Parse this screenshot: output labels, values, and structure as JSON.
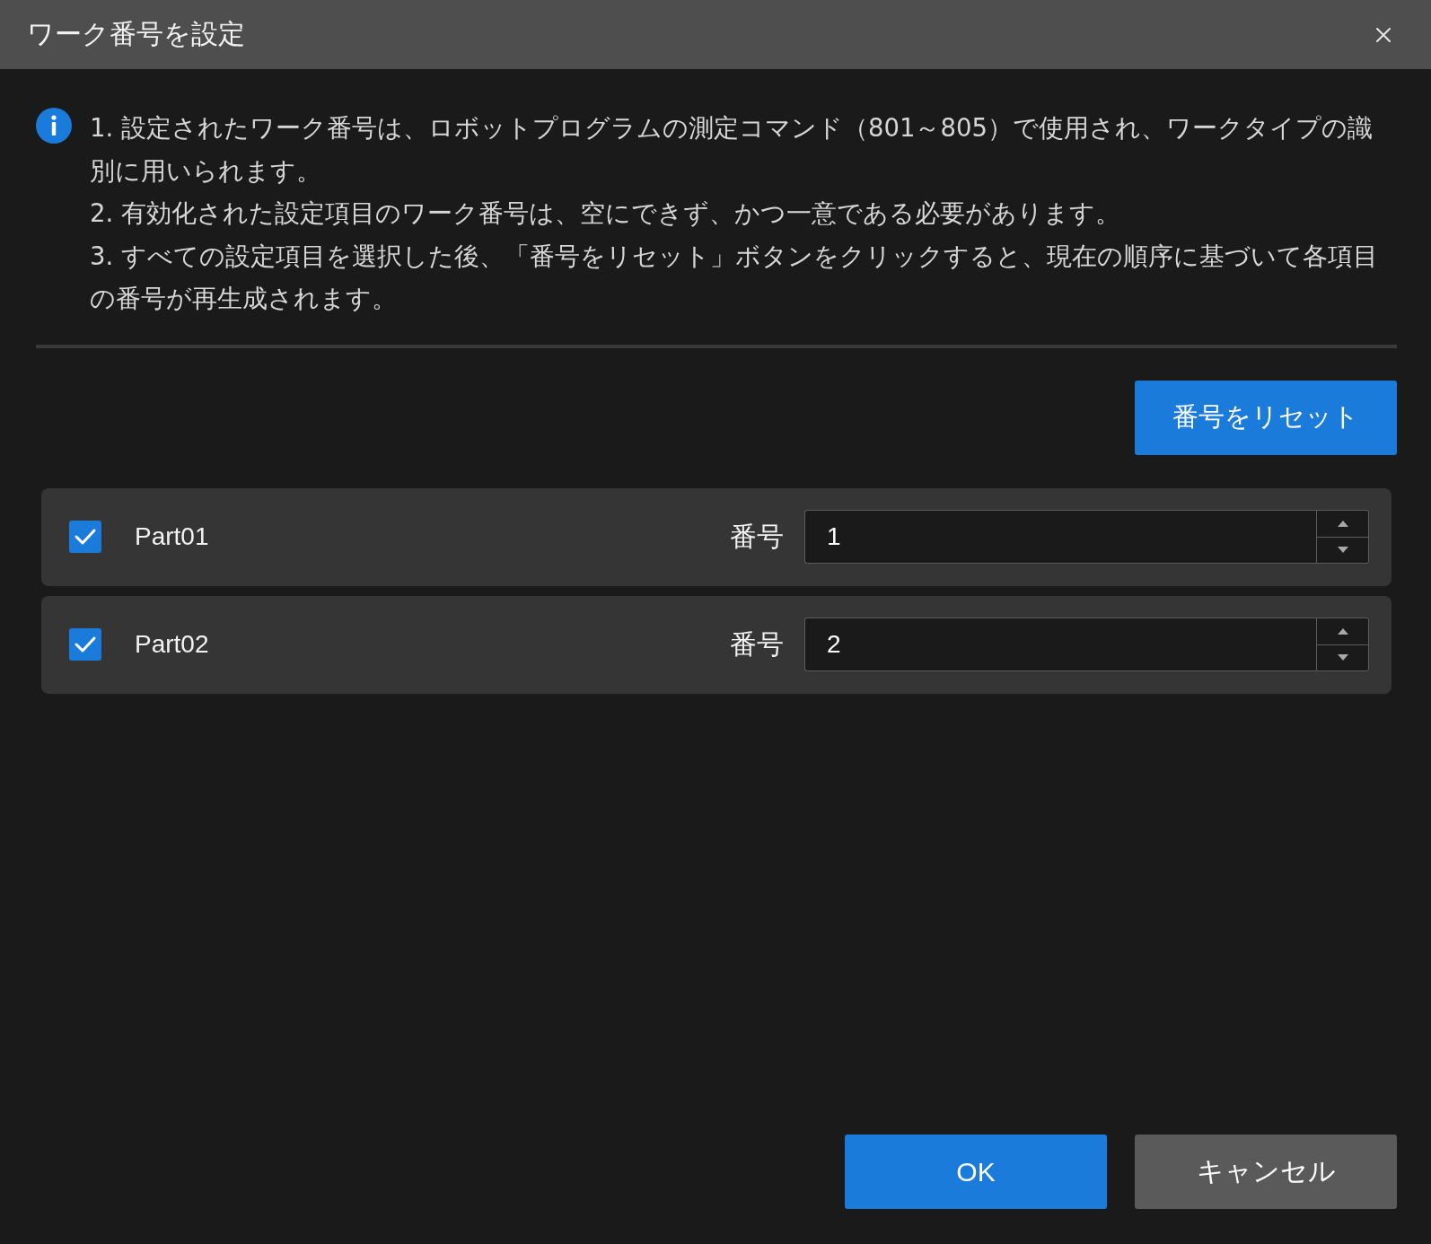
{
  "dialog": {
    "title": "ワーク番号を設定"
  },
  "notes": [
    "1. 設定されたワーク番号は、ロボットプログラムの測定コマンド（801～805）で使用され、ワークタイプの識別に用いられます。",
    "2. 有効化された設定項目のワーク番号は、空にできず、かつ一意である必要があります。",
    "3. すべての設定項目を選択した後、「番号をリセット」ボタンをクリックすると、現在の順序に基づいて各項目の番号が再生成されます。"
  ],
  "reset_button": "番号をリセット",
  "parts": [
    {
      "name": "Part01",
      "checked": true,
      "number_label": "番号",
      "value": "1"
    },
    {
      "name": "Part02",
      "checked": true,
      "number_label": "番号",
      "value": "2"
    }
  ],
  "buttons": [
    {
      "label": "OK",
      "kind": "primary"
    },
    {
      "label": "キャンセル",
      "kind": "secondary"
    }
  ]
}
